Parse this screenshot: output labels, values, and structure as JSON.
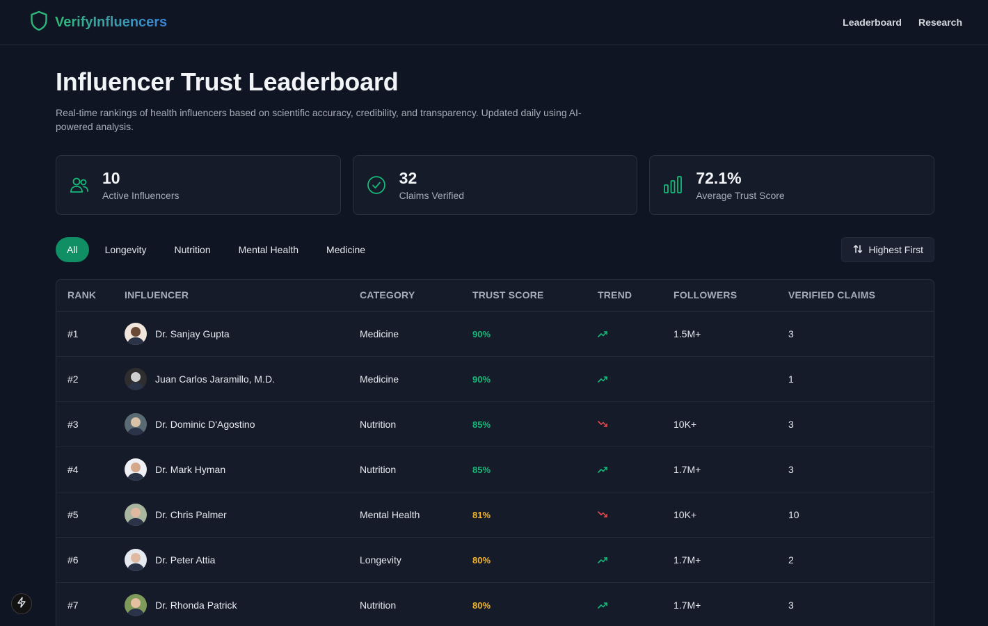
{
  "brand": {
    "name": "VerifyInfluencers"
  },
  "nav": {
    "items": [
      "Leaderboard",
      "Research"
    ]
  },
  "page": {
    "title": "Influencer Trust Leaderboard",
    "subtitle": "Real-time rankings of health influencers based on scientific accuracy, credibility, and transparency. Updated daily using AI-powered analysis."
  },
  "stats": [
    {
      "value": "10",
      "label": "Active Influencers",
      "icon": "users-icon"
    },
    {
      "value": "32",
      "label": "Claims Verified",
      "icon": "check-circle-icon"
    },
    {
      "value": "72.1%",
      "label": "Average Trust Score",
      "icon": "bar-chart-icon"
    }
  ],
  "filters": {
    "categories": [
      "All",
      "Longevity",
      "Nutrition",
      "Mental Health",
      "Medicine"
    ],
    "active": "All",
    "sort_label": "Highest First"
  },
  "table": {
    "headers": [
      "RANK",
      "INFLUENCER",
      "CATEGORY",
      "TRUST SCORE",
      "TREND",
      "FOLLOWERS",
      "VERIFIED CLAIMS"
    ],
    "rows": [
      {
        "rank": "#1",
        "name": "Dr. Sanjay Gupta",
        "category": "Medicine",
        "score": "90%",
        "trend": "up",
        "followers": "1.5M+",
        "claims": "3"
      },
      {
        "rank": "#2",
        "name": "Juan Carlos Jaramillo, M.D.",
        "category": "Medicine",
        "score": "90%",
        "trend": "up",
        "followers": "",
        "claims": "1"
      },
      {
        "rank": "#3",
        "name": "Dr. Dominic D'Agostino",
        "category": "Nutrition",
        "score": "85%",
        "trend": "down",
        "followers": "10K+",
        "claims": "3"
      },
      {
        "rank": "#4",
        "name": "Dr. Mark Hyman",
        "category": "Nutrition",
        "score": "85%",
        "trend": "up",
        "followers": "1.7M+",
        "claims": "3"
      },
      {
        "rank": "#5",
        "name": "Dr. Chris Palmer",
        "category": "Mental Health",
        "score": "81%",
        "trend": "down",
        "followers": "10K+",
        "claims": "10"
      },
      {
        "rank": "#6",
        "name": "Dr. Peter Attia",
        "category": "Longevity",
        "score": "80%",
        "trend": "up",
        "followers": "1.7M+",
        "claims": "2"
      },
      {
        "rank": "#7",
        "name": "Dr. Rhonda Patrick",
        "category": "Nutrition",
        "score": "80%",
        "trend": "up",
        "followers": "1.7M+",
        "claims": "3"
      }
    ]
  },
  "colors": {
    "accent": "#0f8f63",
    "score_high": "#16b97a",
    "score_mid": "#f2b42a",
    "trend_up": "#16b97a",
    "trend_down": "#e5484d"
  }
}
